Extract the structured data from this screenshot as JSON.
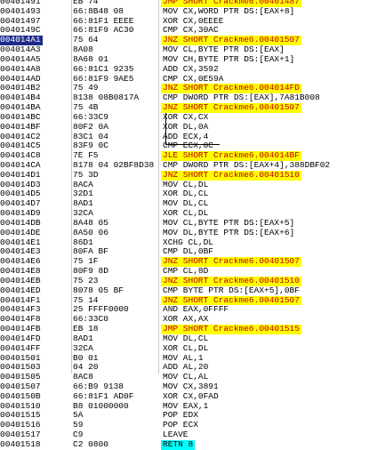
{
  "rows": [
    {
      "addr": "00401491",
      "bytes": "EB 74",
      "asm": "JMP SHORT Crackme6.00401487",
      "kind": "jmp"
    },
    {
      "addr": "00401493",
      "bytes": "66:8B48 08",
      "asm": "MOV CX,WORD PTR DS:[EAX+8]",
      "kind": ""
    },
    {
      "addr": "00401497",
      "bytes": "66:81F1 EEEE",
      "asm": "XOR CX,0EEEE",
      "kind": ""
    },
    {
      "addr": "0040149C",
      "bytes": "66:81F9 AC30",
      "asm": "CMP CX,30AC",
      "kind": ""
    },
    {
      "addr": "004014A1",
      "bytes": "75 64",
      "asm": "JNZ SHORT Crackme6.00401507",
      "kind": "jnz"
    },
    {
      "addr": "004014A3",
      "bytes": "8A08",
      "asm": "MOV CL,BYTE PTR DS:[EAX]",
      "kind": ""
    },
    {
      "addr": "004014A5",
      "bytes": "8A68 01",
      "asm": "MOV CH,BYTE PTR DS:[EAX+1]",
      "kind": ""
    },
    {
      "addr": "004014A8",
      "bytes": "66:81C1 9235",
      "asm": "ADD CX,3592",
      "kind": ""
    },
    {
      "addr": "004014AD",
      "bytes": "66:81F9 9AE5",
      "asm": "CMP CX,0E59A",
      "kind": ""
    },
    {
      "addr": "004014B2",
      "bytes": "75 49",
      "asm": "JNZ SHORT Crackme6.004014FD",
      "kind": "jnz"
    },
    {
      "addr": "004014B4",
      "bytes": "8138 08B0817A",
      "asm": "CMP DWORD PTR DS:[EAX],7A81B008",
      "kind": ""
    },
    {
      "addr": "004014BA",
      "bytes": "75 4B",
      "asm": "JNZ SHORT Crackme6.00401507",
      "kind": "jnz"
    },
    {
      "addr": "004014BC",
      "bytes": "66:33C9",
      "asm": "XOR CX,CX",
      "kind": ""
    },
    {
      "addr": "004014BF",
      "bytes": "80F2 0A",
      "asm": "XOR DL,0A",
      "kind": "",
      "red": true
    },
    {
      "addr": "004014C2",
      "bytes": "83C1 04",
      "asm": "ADD ECX,4",
      "kind": "",
      "red": true
    },
    {
      "addr": "004014C5",
      "bytes": "83F9 0C",
      "asm": "CMP ECX,0C",
      "kind": "",
      "red": true
    },
    {
      "addr": "004014C8",
      "bytes": "7E F5",
      "asm": "JLE SHORT Crackme6.004014BF",
      "kind": "jle"
    },
    {
      "addr": "004014CA",
      "bytes": "8178 04 02BF8D38",
      "asm": "CMP DWORD PTR DS:[EAX+4],388DBF02",
      "kind": ""
    },
    {
      "addr": "004014D1",
      "bytes": "75 3D",
      "asm": "JNZ SHORT Crackme6.00401510",
      "kind": "jnz"
    },
    {
      "addr": "004014D3",
      "bytes": "8ACA",
      "asm": "MOV CL,DL",
      "kind": ""
    },
    {
      "addr": "004014D5",
      "bytes": "32D1",
      "asm": "XOR DL,CL",
      "kind": ""
    },
    {
      "addr": "004014D7",
      "bytes": "8AD1",
      "asm": "MOV DL,CL",
      "kind": ""
    },
    {
      "addr": "004014D9",
      "bytes": "32CA",
      "asm": "XOR CL,DL",
      "kind": ""
    },
    {
      "addr": "004014DB",
      "bytes": "8A48 05",
      "asm": "MOV CL,BYTE PTR DS:[EAX+5]",
      "kind": ""
    },
    {
      "addr": "004014DE",
      "bytes": "8A50 06",
      "asm": "MOV DL,BYTE PTR DS:[EAX+6]",
      "kind": ""
    },
    {
      "addr": "004014E1",
      "bytes": "86D1",
      "asm": "XCHG CL,DL",
      "kind": ""
    },
    {
      "addr": "004014E3",
      "bytes": "80FA BF",
      "asm": "CMP DL,0BF",
      "kind": "",
      "red": true
    },
    {
      "addr": "004014E6",
      "bytes": "75 1F",
      "asm": "JNZ SHORT Crackme6.00401507",
      "kind": "jnz"
    },
    {
      "addr": "004014E8",
      "bytes": "80F9 8D",
      "asm": "CMP CL,8D",
      "kind": "",
      "red": true
    },
    {
      "addr": "004014EB",
      "bytes": "75 23",
      "asm": "JNZ SHORT Crackme6.00401510",
      "kind": "jnz"
    },
    {
      "addr": "004014ED",
      "bytes": "8078 05 BF",
      "asm": "CMP BYTE PTR DS:[EAX+5],0BF",
      "kind": ""
    },
    {
      "addr": "004014F1",
      "bytes": "75 14",
      "asm": "JNZ SHORT Crackme6.00401507",
      "kind": "jnz"
    },
    {
      "addr": "004014F3",
      "bytes": "25 FFFF0000",
      "asm": "AND EAX,0FFFF",
      "kind": "",
      "red": true
    },
    {
      "addr": "004014F8",
      "bytes": "66:33C0",
      "asm": "XOR AX,AX",
      "kind": ""
    },
    {
      "addr": "004014FB",
      "bytes": "EB 18",
      "asm": "JMP SHORT Crackme6.00401515",
      "kind": "jmp"
    },
    {
      "addr": "004014FD",
      "bytes": "8AD1",
      "asm": "MOV DL,CL",
      "kind": ""
    },
    {
      "addr": "004014FF",
      "bytes": "32CA",
      "asm": "XOR CL,DL",
      "kind": ""
    },
    {
      "addr": "00401501",
      "bytes": "B0 01",
      "asm": "MOV AL,1",
      "kind": "",
      "red": true
    },
    {
      "addr": "00401503",
      "bytes": "04 20",
      "asm": "ADD AL,20",
      "kind": "",
      "red": true
    },
    {
      "addr": "00401505",
      "bytes": "8AC8",
      "asm": "MOV CL,AL",
      "kind": ""
    },
    {
      "addr": "00401507",
      "bytes": "66:B9 9138",
      "asm": "MOV CX,3891",
      "kind": "",
      "red": true
    },
    {
      "addr": "0040150B",
      "bytes": "66:81F1 AD0F",
      "asm": "XOR CX,0FAD",
      "kind": "",
      "red": true
    },
    {
      "addr": "00401510",
      "bytes": "B8 01000000",
      "asm": "MOV EAX,1",
      "kind": "",
      "red": true
    },
    {
      "addr": "00401515",
      "bytes": "5A",
      "asm": "POP EDX",
      "kind": ""
    },
    {
      "addr": "00401516",
      "bytes": "59",
      "asm": "POP ECX",
      "kind": ""
    },
    {
      "addr": "00401517",
      "bytes": "C9",
      "asm": "LEAVE",
      "kind": ""
    },
    {
      "addr": "00401518",
      "bytes": "C2 0800",
      "asm": "RETN 8",
      "kind": "retn"
    }
  ],
  "selected_addr": "004014A1"
}
